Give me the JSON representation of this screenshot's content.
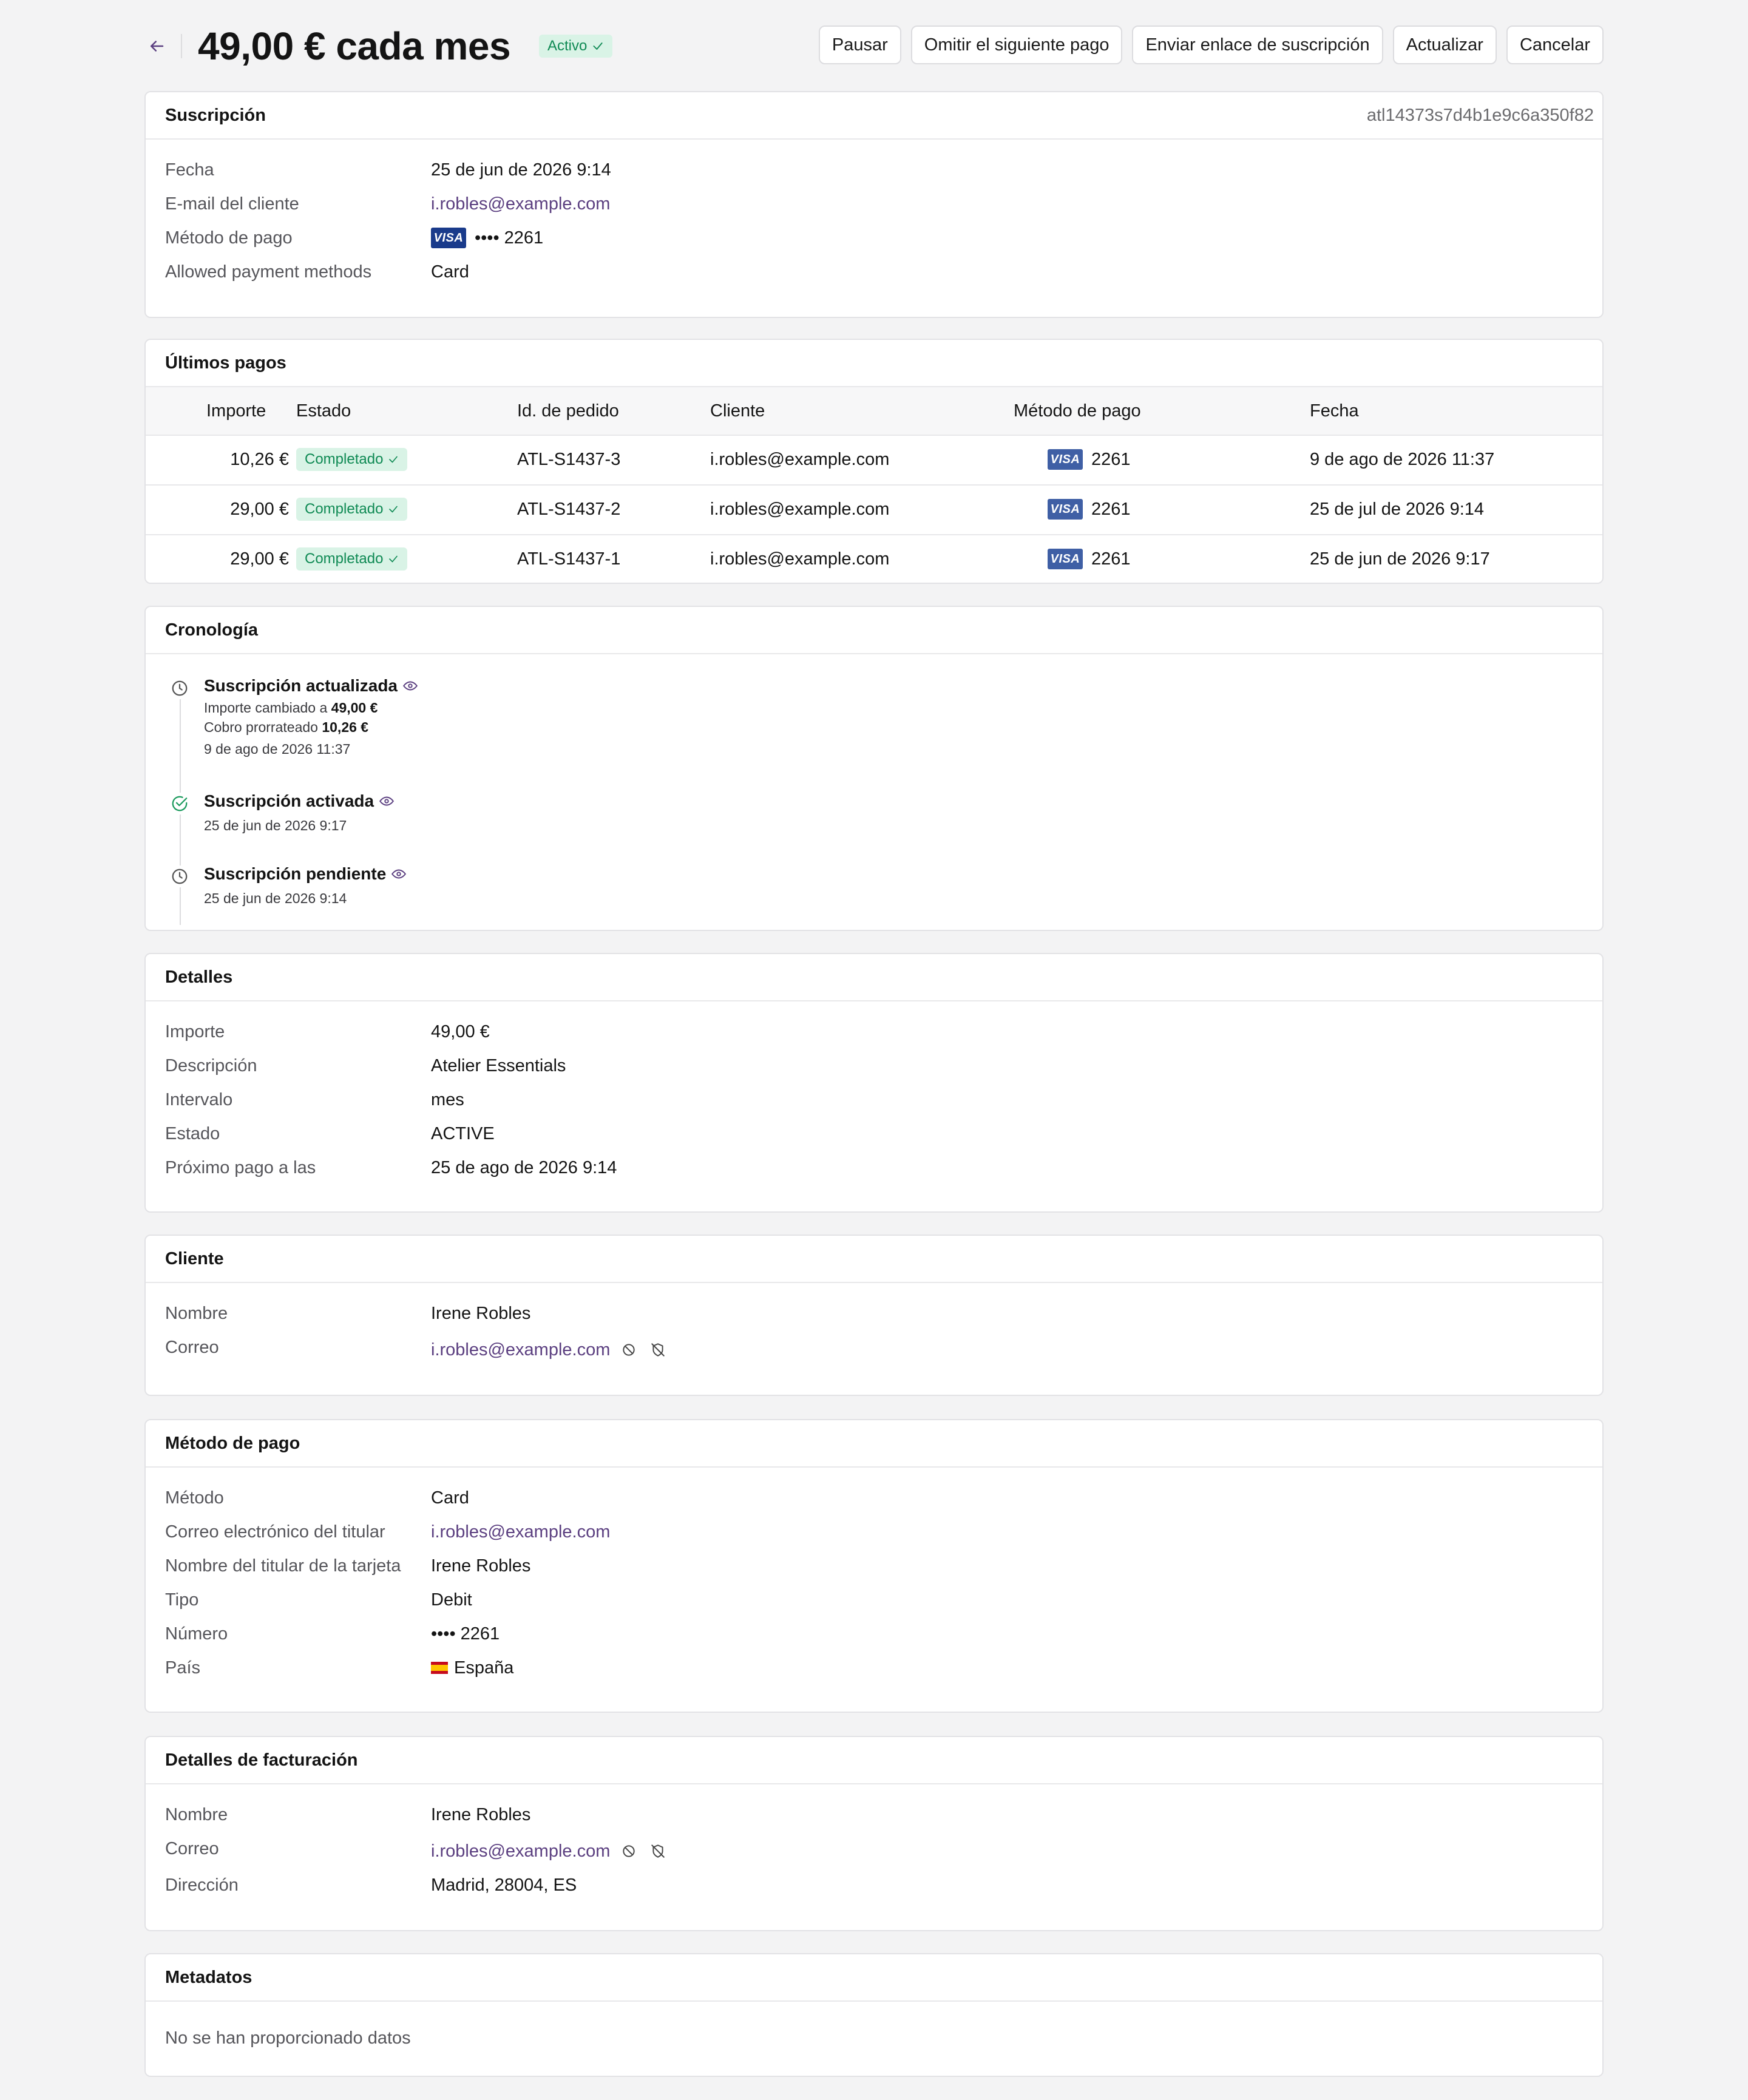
{
  "header": {
    "title": "49,00 € cada mes",
    "status": "Activo",
    "actions": [
      "Pausar",
      "Omitir el siguiente pago",
      "Enviar enlace de suscripción",
      "Actualizar",
      "Cancelar"
    ]
  },
  "subscription": {
    "title": "Suscripción",
    "id": "atl14373s7d4b1e9c6a350f82",
    "rows": [
      {
        "label": "Fecha",
        "value": "25 de jun de 2026 9:14"
      },
      {
        "label": "E-mail del cliente",
        "value": "i.robles@example.com"
      },
      {
        "label": "Método de pago",
        "value": "•••• 2261",
        "card_brand": "VISA"
      },
      {
        "label": "Allowed payment methods",
        "value": "Card"
      }
    ]
  },
  "payments": {
    "title": "Últimos pagos",
    "columns": [
      "Importe",
      "Estado",
      "Id. de pedido",
      "Cliente",
      "Método de pago",
      "Fecha"
    ],
    "rows": [
      {
        "amount": "10,26 €",
        "status": "Completado",
        "order": "ATL-S1437-3",
        "customer": "i.robles@example.com",
        "brand": "VISA",
        "last4": "2261",
        "date": "9 de ago de 2026 11:37"
      },
      {
        "amount": "29,00 €",
        "status": "Completado",
        "order": "ATL-S1437-2",
        "customer": "i.robles@example.com",
        "brand": "VISA",
        "last4": "2261",
        "date": "25 de jul de 2026 9:14"
      },
      {
        "amount": "29,00 €",
        "status": "Completado",
        "order": "ATL-S1437-1",
        "customer": "i.robles@example.com",
        "brand": "VISA",
        "last4": "2261",
        "date": "25 de jun de 2026 9:17"
      }
    ]
  },
  "timeline": {
    "title": "Cronología",
    "events": [
      {
        "title": "Suscripción actualizada",
        "icon": "clock-icon",
        "line1_label": "Importe cambiado a",
        "line1_value": "49,00 €",
        "line2_label": "Cobro prorrateado",
        "line2_value": "10,26 €",
        "date": "9 de ago de 2026 11:37"
      },
      {
        "title": "Suscripción activada",
        "icon": "check-circle-icon",
        "date": "25 de jun de 2026 9:17"
      },
      {
        "title": "Suscripción pendiente",
        "icon": "clock-icon",
        "date": "25 de jun de 2026 9:14"
      }
    ]
  },
  "details": {
    "title": "Detalles",
    "rows": [
      {
        "label": "Importe",
        "value": "49,00 €"
      },
      {
        "label": "Descripción",
        "value": "Atelier Essentials"
      },
      {
        "label": "Intervalo",
        "value": "mes"
      },
      {
        "label": "Estado",
        "value": "ACTIVE"
      },
      {
        "label": "Próximo pago a las",
        "value": "25 de ago de 2026 9:14"
      }
    ]
  },
  "customer": {
    "title": "Cliente",
    "rows": [
      {
        "label": "Nombre",
        "value": "Irene Robles"
      },
      {
        "label": "Correo",
        "value": "i.robles@example.com"
      }
    ]
  },
  "payment_method": {
    "title": "Método de pago",
    "rows": [
      {
        "label": "Método",
        "value": "Card"
      },
      {
        "label": "Correo electrónico del titular",
        "value": "i.robles@example.com"
      },
      {
        "label": "Nombre del titular de la tarjeta",
        "value": "Irene Robles"
      },
      {
        "label": "Tipo",
        "value": "Debit"
      },
      {
        "label": "Número",
        "value": "•••• 2261"
      },
      {
        "label": "País",
        "value": "España"
      }
    ]
  },
  "billing": {
    "title": "Detalles de facturación",
    "rows": [
      {
        "label": "Nombre",
        "value": "Irene Robles"
      },
      {
        "label": "Correo",
        "value": "i.robles@example.com"
      },
      {
        "label": "Dirección",
        "value": "Madrid, 28004, ES"
      }
    ]
  },
  "metadata": {
    "title": "Metadatos",
    "empty": "No se han proporcionado datos"
  },
  "colors": {
    "accent": "#5b3f80",
    "success_bg": "#d9f3e6",
    "success_text": "#0f8a54",
    "visa_blue": "#1a3b8b"
  }
}
